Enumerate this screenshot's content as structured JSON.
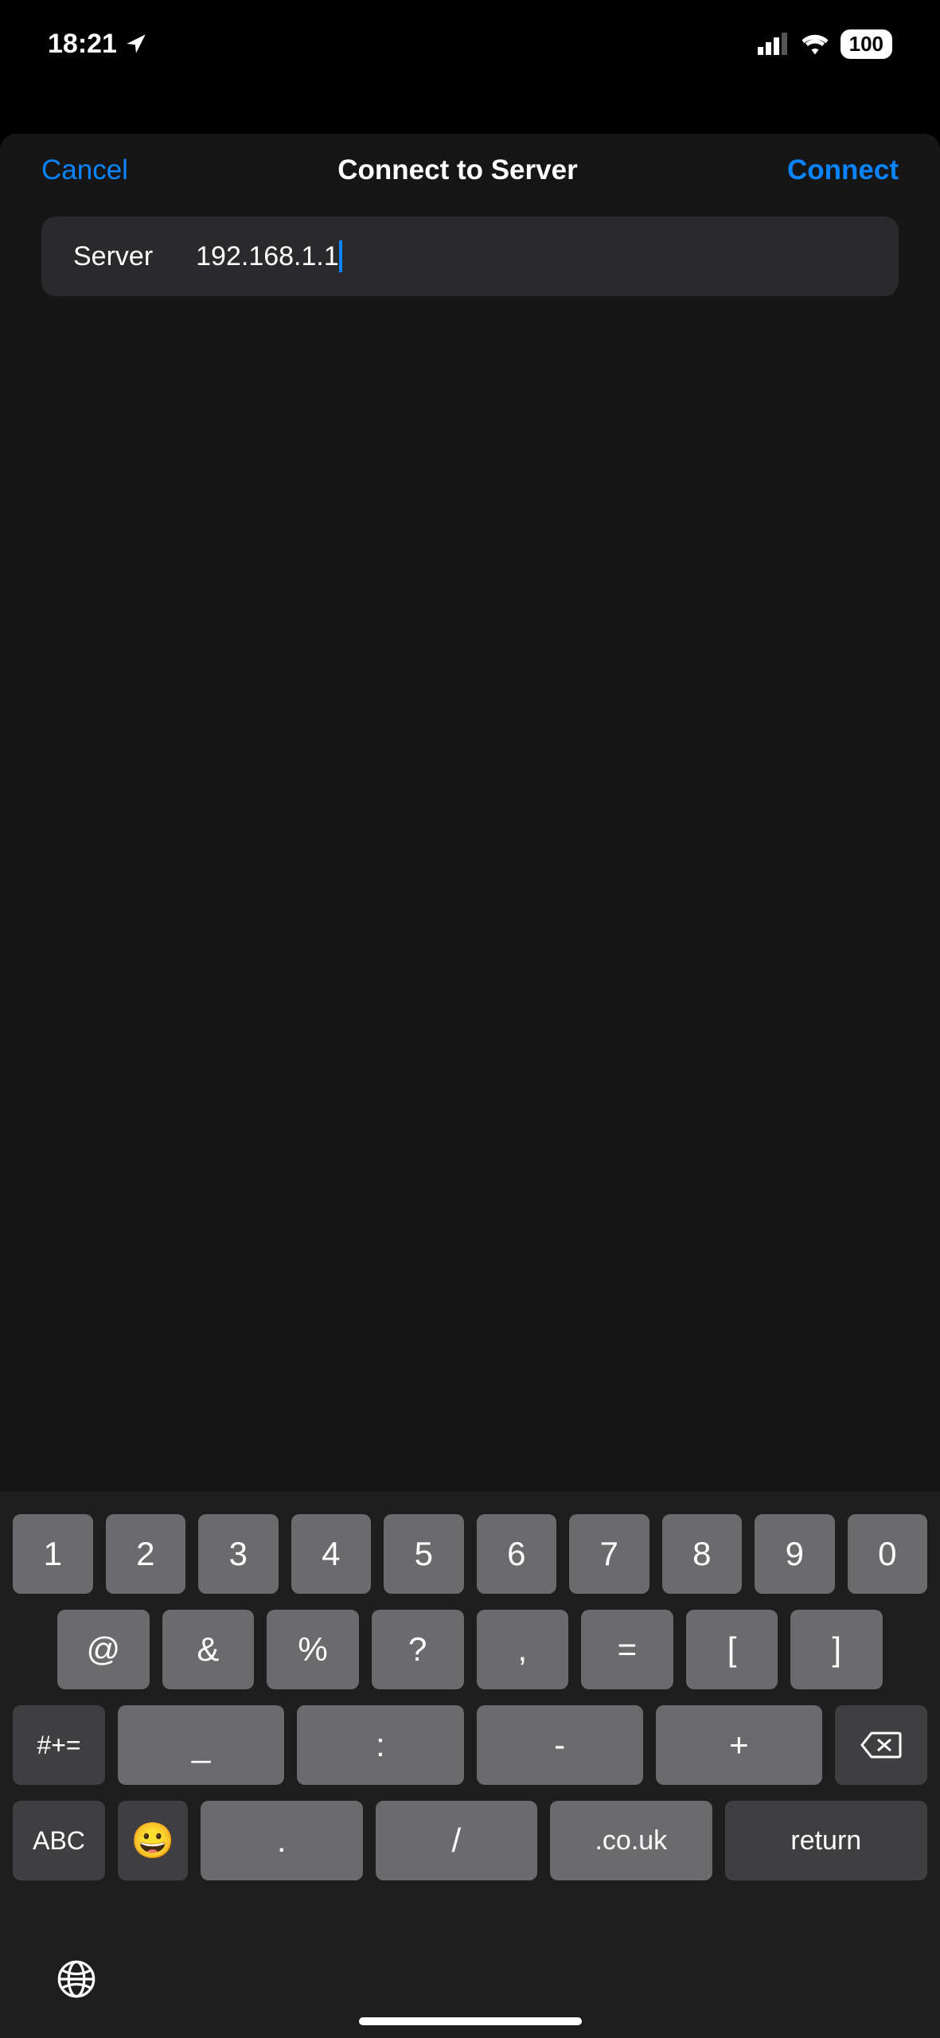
{
  "status": {
    "time": "18:21",
    "battery": "100"
  },
  "nav": {
    "cancel": "Cancel",
    "title": "Connect to Server",
    "connect": "Connect"
  },
  "field": {
    "label": "Server",
    "value": "192.168.1.1"
  },
  "keyboard": {
    "row1": [
      "1",
      "2",
      "3",
      "4",
      "5",
      "6",
      "7",
      "8",
      "9",
      "0"
    ],
    "row2": [
      "@",
      "&",
      "%",
      "?",
      ",",
      "=",
      "[",
      "]"
    ],
    "row3": {
      "sym": "#+=",
      "keys": [
        "_",
        ":",
        "-",
        "+"
      ]
    },
    "row4": {
      "abc": "ABC",
      "period": ".",
      "slash": "/",
      "domain": ".co.uk",
      "return": "return"
    }
  }
}
